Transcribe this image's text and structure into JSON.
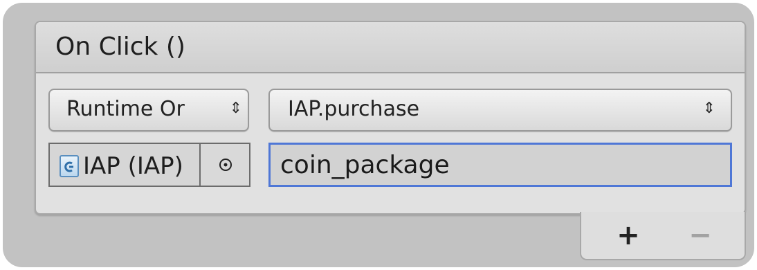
{
  "event": {
    "title": "On Click ()"
  },
  "entry": {
    "runtime_mode": "Runtime Or",
    "runtime_mode_arrows": "⇕",
    "method": "IAP.purchase",
    "method_arrows": "⇕",
    "target_object": "IAP (IAP)",
    "argument_value": "coin_package"
  },
  "footer": {
    "add_label": "+",
    "remove_label": "−"
  },
  "icons": {
    "target": "script-component-icon",
    "picker": "object-picker-icon"
  },
  "colors": {
    "focus_border": "#4f77d6",
    "icon_blue": "#5a8fbf"
  }
}
